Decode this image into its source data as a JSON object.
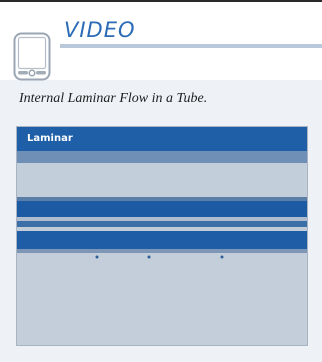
{
  "header": {
    "title": "VIDEO"
  },
  "caption": "Internal Laminar Flow in a Tube.",
  "video": {
    "label": "Laminar"
  }
}
